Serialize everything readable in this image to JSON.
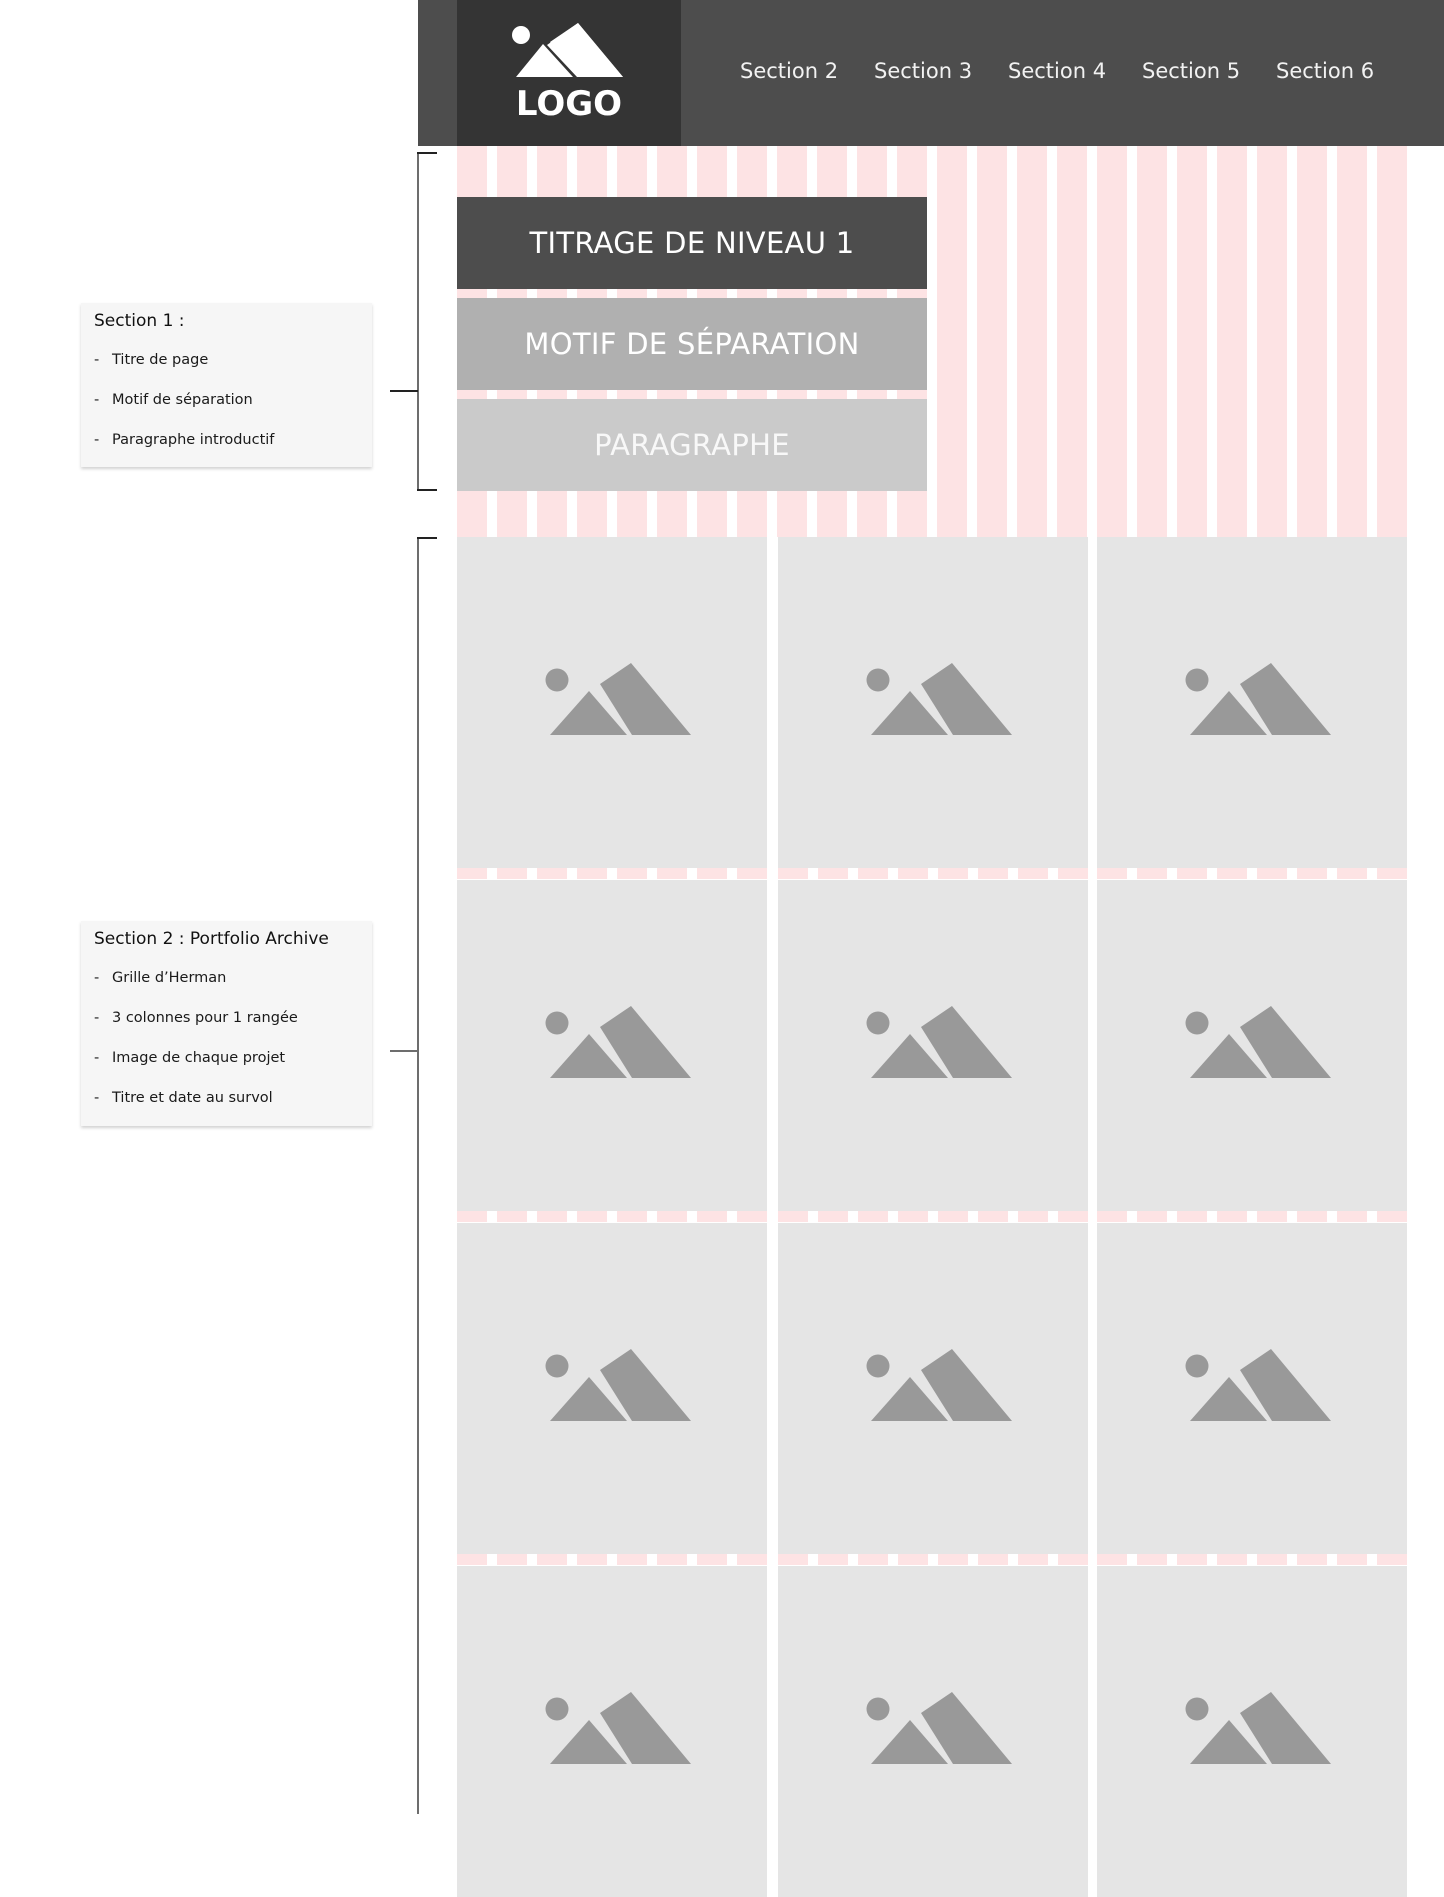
{
  "header": {
    "logo": {
      "icon": "mountain-image-icon",
      "label": "LOGO"
    },
    "nav": [
      "Section 2",
      "Section 3",
      "Section 4",
      "Section 5",
      "Section 6"
    ]
  },
  "hero": {
    "title": "TITRAGE DE NIVEAU 1",
    "separator": "MOTIF DE SÉPARATION",
    "paragraph": "PARAGRAPHE"
  },
  "portfolio": {
    "columns": 3,
    "rows_visible": 4,
    "placeholder_icon": "image-placeholder-icon"
  },
  "annotations": [
    {
      "title": "Section 1 :",
      "items": [
        "Titre de page",
        "Motif de séparation",
        "Paragraphe introductif"
      ]
    },
    {
      "title": "Section 2 : Portfolio Archive",
      "items": [
        "Grille d’Herman",
        "3 colonnes pour 1 rangée",
        "Image de chaque projet",
        "Titre et date au survol"
      ]
    }
  ],
  "colors": {
    "header_bg": "#4d4d4d",
    "logo_bg": "#343434",
    "grid_pink": "#fde3e4",
    "title_bg": "#4d4d4d",
    "separator_bg": "#b0b0b0",
    "paragraph_bg": "#cacaca",
    "cell_bg": "#e5e5e5",
    "icon_gray": "#999999"
  }
}
